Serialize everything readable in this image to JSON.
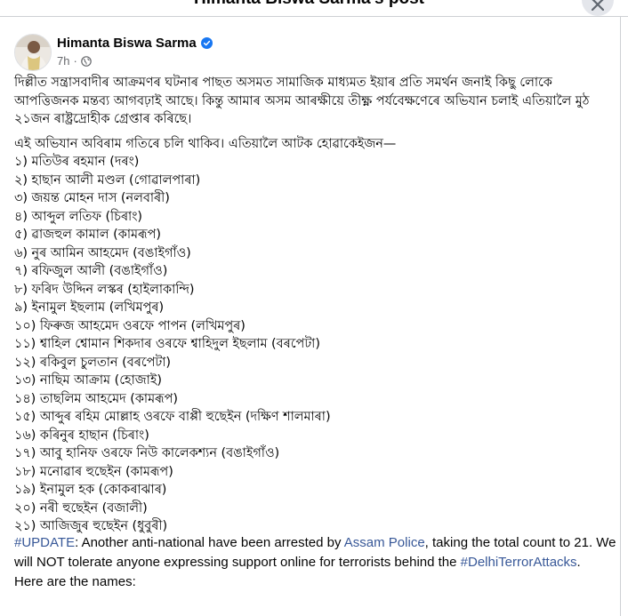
{
  "dialog": {
    "title": "Himanta Biswa Sarma's post"
  },
  "post": {
    "author": "Himanta Biswa Sarma",
    "time": "7h",
    "separator": "·",
    "paragraph1": "দিল্লীত সন্ত্ৰাসবাদীৰ আক্ৰমণৰ ঘটনাৰ পাছত অসমত সামাজিক মাধ্যমত ইয়াৰ প্ৰতি সমৰ্থন জনাই কিছু লোকে আপত্তিজনক মন্তব্য আগবঢ়াই আছে। কিন্তু আমাৰ অসম আৰক্ষীয়ে তীক্ষ্ণ পৰ্যবেক্ষণেৰে অভিযান চলাই এতিয়ালৈ মুঠ ২১জন ৰাষ্ট্ৰদ্ৰোহীক গ্ৰেপ্তাৰ কৰিছে।",
    "paragraph2": "এই অভিযান অবিৰাম গতিৰে চলি থাকিব। এতিয়ালৈ আটক হোৱাকেইজন—",
    "arrested": [
      "১) মতিউৰ ৰহমান (দৰং)",
      "২) হাছান আলী মণ্ডল (গোৱালপাৰা)",
      "৩) জয়ন্ত মোহন দাস (নলবাৰী)",
      "৪) আব্দুল লতিফ (চিৰাং)",
      "৫) ৱাজহুল কামাল (কামৰূপ)",
      "৬) নুৰ আমিন আহমেদ (বঙাইগাঁও)",
      "৭) ৰফিজুল আলী (বঙাইগাঁও)",
      "৮) ফৰিদ উদ্দিন লস্কৰ (হাইলাকান্দি)",
      "৯) ইনামুল ইছলাম (লখিমপুৰ)",
      "১০) ফিৰুজ আহমেদ ওৰফে পাপন (লখিমপুৰ)",
      "১১) শ্বাহিল শ্বোমান শিকদাৰ ওৰফে শ্বাহিদুল ইছলাম (বৰপেটা)",
      "১২) ৰকিবুল চুলতান (বৰপেটা)",
      "১৩) নাছিম আক্ৰাম (হোজাই)",
      "১৪) তাছলিম আহমেদ (কামৰূপ)",
      "১৫) আব্দুৰ ৰহিম মোল্লাহ ওৰফে বাপ্পী হুছেইন (দক্ষিণ শালমাৰা)",
      "১৬) কৰিনুৰ হাছান (চিৰাং)",
      "১৭) আবু হানিফ ওৰফে নিউ কালেকশ্যন (বঙাইগাঁও)",
      "১৮) মনোৱাৰ হুছেইন (কামৰূপ)",
      "১৯) ইনামুল হক (কোকৰাঝাৰ)",
      "২০) নৰী হুছেইন (বজালী)",
      "২১) আজিজুৰ হুছেইন (ধুবুৰী)"
    ],
    "update": {
      "hashtag_update": "#UPDATE",
      "text1": ": Another anti-national have been arrested by ",
      "assam_police": "Assam Police",
      "text2": ", taking the total count to 21. We will NOT tolerate anyone expressing support online for terrorists behind the ",
      "hashtag_delhi": "#DelhiTerrorAttacks",
      "text3": ".",
      "text4": "Here are the names:"
    }
  },
  "icons": {
    "close": "close-icon",
    "verified": "verified-badge-icon",
    "audience": "globe-icon"
  },
  "colors": {
    "verified_blue": "#1877f2",
    "link_blue": "#385898",
    "meta_gray": "#65676b",
    "close_bg": "#e4e6eb"
  }
}
